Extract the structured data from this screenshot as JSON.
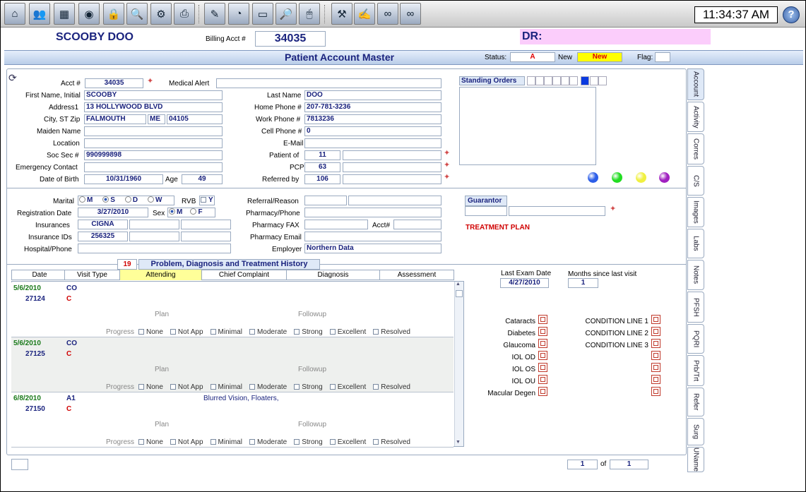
{
  "toolbar": {
    "icons": [
      "home-icon",
      "people-icon",
      "calendar-icon",
      "database-icon",
      "lock-icon",
      "document-search-icon",
      "document-settings-icon",
      "printer-icon",
      "edit-icon",
      "gauge-icon",
      "scanner-icon",
      "search-document-icon",
      "mouse-icon",
      "tools-icon",
      "edit-note-icon",
      "glasses-icon",
      "eyeglasses-icon"
    ],
    "clock": "11:34:37 AM"
  },
  "header": {
    "patient_name": "SCOOBY DOO",
    "billing_label": "Billing Acct #",
    "billing_acct": "34035",
    "dr_label": "DR:"
  },
  "title_bar": {
    "title": "Patient Account Master",
    "status_label": "Status:",
    "status": "A",
    "new_label": "New",
    "new_value": "New",
    "flag_label": "Flag:"
  },
  "account": {
    "acct_label": "Acct #",
    "acct": "34035",
    "medical_alert_label": "Medical Alert",
    "first_name_label": "First Name, Initial",
    "first_name": "SCOOBY",
    "address_label": "Address1",
    "address": "13 HOLLYWOOD BLVD",
    "city_label": "City, ST Zip",
    "city": "FALMOUTH",
    "state": "ME",
    "zip": "04105",
    "maiden_label": "Maiden Name",
    "location_label": "Location",
    "ssn_label": "Soc Sec #",
    "ssn": "990999898",
    "emergency_label": "Emergency Contact",
    "dob_label": "Date of Birth",
    "dob": "10/31/1960",
    "age_label": "Age",
    "age": "49",
    "last_name_label": "Last Name",
    "last_name": "DOO",
    "home_phone_label": "Home Phone #",
    "home_phone": "207-781-3236",
    "work_phone_label": "Work Phone #",
    "work_phone": "7813236",
    "cell_phone_label": "Cell Phone #",
    "cell_phone": "0",
    "email_label": "E-Mail",
    "patient_of_label": "Patient of",
    "patient_of": "11",
    "pcp_label": "PCP",
    "pcp": "63",
    "referred_label": "Referred by",
    "referred": "106",
    "standing_orders": "Standing Orders"
  },
  "dot_colors": [
    "#2c5ee8",
    "#22dd22",
    "#f0f040",
    "#a020c0"
  ],
  "second": {
    "marital_label": "Marital",
    "marital_options": [
      "M",
      "S",
      "D",
      "W"
    ],
    "rvb_label": "RVB",
    "rvb_option": "Y",
    "reg_date_label": "Registration Date",
    "reg_date": "3/27/2010",
    "sex_label": "Sex",
    "sex_options": [
      "M",
      "F"
    ],
    "insurances_label": "Insurances",
    "insurance1": "CIGNA",
    "insurance_ids_label": "Insurance IDs",
    "insurance_id1": "256325",
    "hospital_label": "Hospital/Phone",
    "referral_label": "Referral/Reason",
    "pharmacy_phone_label": "Pharmacy/Phone",
    "pharmacy_fax_label": "Pharmacy FAX",
    "acct_label": "Acct#",
    "pharmacy_email_label": "Pharmacy Email",
    "employer_label": "Employer",
    "employer": "Northern Data",
    "guarantor": "Guarantor",
    "treatment_plan": "TREATMENT PLAN"
  },
  "history": {
    "count": "19",
    "tab_title": "Problem, Diagnosis and Treatment History",
    "columns": [
      "Date",
      "Visit Type",
      "Attending",
      "Chief Complaint",
      "Diagnosis",
      "Assessment"
    ],
    "plan_label": "Plan",
    "followup_label": "Followup",
    "progress_label": "Progress",
    "progress_options": [
      "None",
      "Not App",
      "Minimal",
      "Moderate",
      "Strong",
      "Excellent",
      "Resolved"
    ],
    "rows": [
      {
        "date": "5/6/2010",
        "visit_type": "CO",
        "id": "27124",
        "flag": "C",
        "complaint": ""
      },
      {
        "date": "5/6/2010",
        "visit_type": "CO",
        "id": "27125",
        "flag": "C",
        "complaint": ""
      },
      {
        "date": "6/8/2010",
        "visit_type": "A1",
        "id": "27150",
        "flag": "C",
        "complaint": "Blurred Vision,  Floaters,"
      }
    ]
  },
  "exam": {
    "last_exam_label": "Last Exam Date",
    "last_exam": "4/27/2010",
    "months_label": "Months since last visit",
    "months": "1"
  },
  "conditions_left": [
    "Cataracts",
    "Diabetes",
    "Glaucoma",
    "IOL OD",
    "IOL OS",
    "IOL OU",
    "Macular Degen"
  ],
  "conditions_right": [
    "CONDITION LINE 1",
    "CONDITION LINE 2",
    "CONDITION LINE 3"
  ],
  "side_tabs": [
    "Account",
    "Activity",
    "Corres",
    "C/S",
    "Images",
    "Labs",
    "Notes",
    "PFSH",
    "PQRI",
    "Prb/Trt",
    "Refer",
    "Surg",
    "UName"
  ],
  "pager": {
    "current": "1",
    "of_label": "of",
    "total": "1"
  }
}
